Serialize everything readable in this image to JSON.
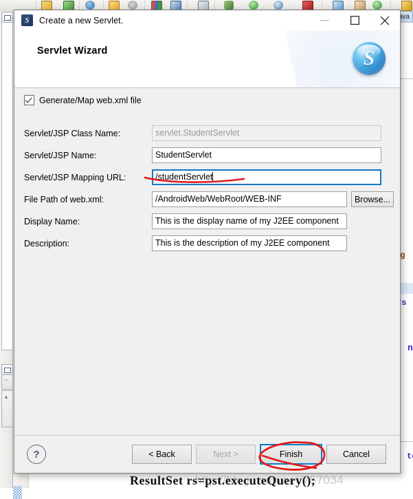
{
  "dialog": {
    "title": "Create a new Servlet.",
    "title_icon": "servlet-wizard-icon",
    "wizard_heading": "Servlet Wizard",
    "logo_letter": "S",
    "window_controls": {
      "minimize": "minimize-icon",
      "maximize": "maximize-icon",
      "close": "close-icon"
    },
    "checkbox": {
      "label": "Generate/Map web.xml file",
      "checked": true
    },
    "fields": [
      {
        "label": "Servlet/JSP Class Name:",
        "value": "servlet.StudentServlet",
        "readonly": true,
        "focused": false,
        "name": "servlet-class-name"
      },
      {
        "label": "Servlet/JSP Name:",
        "value": "StudentServlet",
        "readonly": false,
        "focused": false,
        "name": "servlet-name"
      },
      {
        "label": "Servlet/JSP Mapping URL:",
        "value": "/studentServlet",
        "readonly": false,
        "focused": true,
        "name": "servlet-mapping-url"
      },
      {
        "label": "File Path of web.xml:",
        "value": "/AndroidWeb/WebRoot/WEB-INF",
        "readonly": false,
        "focused": false,
        "name": "webxml-file-path"
      },
      {
        "label": "Display Name:",
        "value": "This is the display name of my J2EE component",
        "readonly": false,
        "focused": false,
        "name": "display-name"
      },
      {
        "label": "Description:",
        "value": "This is the description of my J2EE component",
        "readonly": false,
        "focused": false,
        "name": "description"
      }
    ],
    "browse_label": "Browse...",
    "help_label": "?",
    "buttons": {
      "back": "< Back",
      "next": "Next >",
      "finish": "Finish",
      "cancel": "Cancel"
    }
  },
  "annotations": {
    "accent_color": "#e01b1b",
    "focus_color": "#1278c8",
    "underline_target": "servlet-mapping-url",
    "circle_target": "finish-button"
  },
  "background": {
    "editor_tab_label": "ava",
    "code_big_line": "ResultSet rs=pst.executeQuery();",
    "watermark": "http://blog.csdn.net/757034",
    "code_fragments": [
      "ng",
      "<s",
      "na",
      "te"
    ]
  }
}
